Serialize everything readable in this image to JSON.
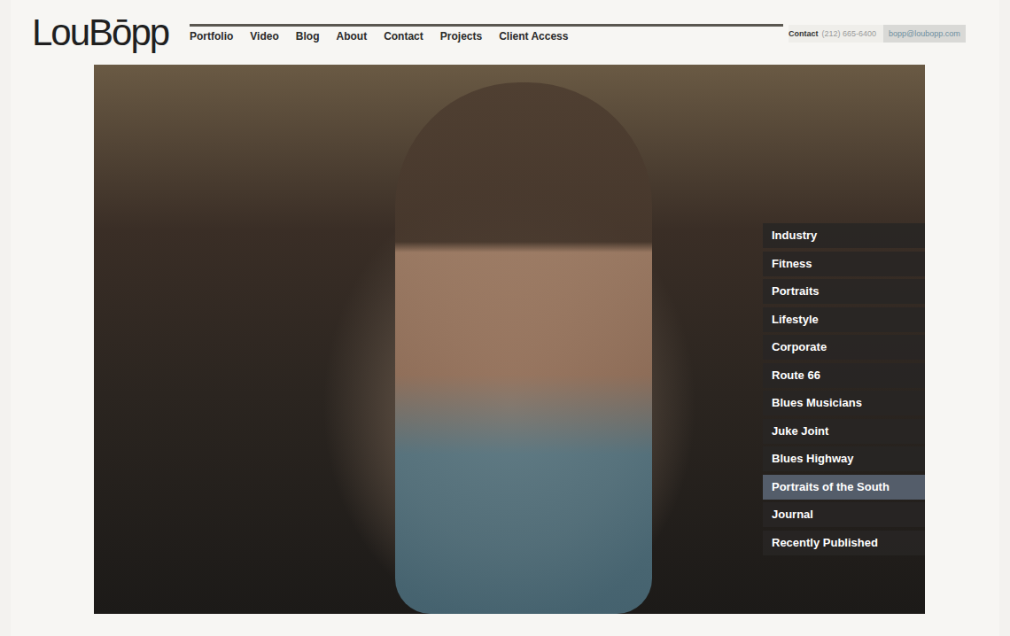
{
  "header": {
    "logo": "LouBōpp",
    "nav": [
      {
        "label": "Portfolio",
        "selected": false
      },
      {
        "label": "Video",
        "selected": false
      },
      {
        "label": "Blog",
        "selected": false
      },
      {
        "label": "About",
        "selected": false
      },
      {
        "label": "Contact",
        "selected": false
      },
      {
        "label": "Projects",
        "selected": false
      },
      {
        "label": "Client Access",
        "selected": false
      }
    ],
    "contact": {
      "label": "Contact",
      "phone": "(212) 665-6400",
      "email": "bopp@loubopp.com"
    }
  },
  "gallery_menu": [
    {
      "label": "Industry",
      "selected": false
    },
    {
      "label": "Fitness",
      "selected": false
    },
    {
      "label": "Portraits",
      "selected": false
    },
    {
      "label": "Lifestyle",
      "selected": false
    },
    {
      "label": "Corporate",
      "selected": false
    },
    {
      "label": "Route 66",
      "selected": false
    },
    {
      "label": "Blues Musicians",
      "selected": false
    },
    {
      "label": "Juke Joint",
      "selected": false
    },
    {
      "label": "Blues Highway",
      "selected": false
    },
    {
      "label": "Portraits of the South",
      "selected": true
    },
    {
      "label": "Journal",
      "selected": false
    },
    {
      "label": "Recently Published",
      "selected": false
    }
  ]
}
